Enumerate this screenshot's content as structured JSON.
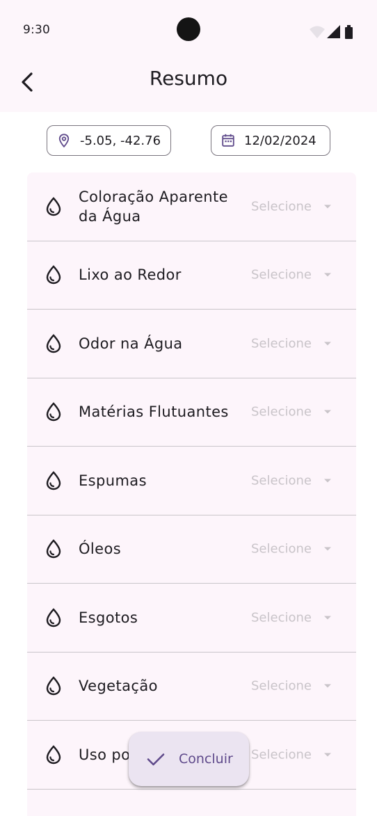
{
  "status_bar": {
    "time": "9:30",
    "icons": [
      "wifi-icon",
      "signal-icon",
      "battery-icon"
    ]
  },
  "app_bar": {
    "title": "Resumo",
    "back_icon": "chevron-left-icon"
  },
  "chips": {
    "location": {
      "icon": "location-pin-icon",
      "value": "-5.05, -42.76"
    },
    "date": {
      "icon": "calendar-icon",
      "value": "12/02/2024"
    }
  },
  "items": [
    {
      "label": "Coloração Aparente da Água",
      "placeholder": "Selecione",
      "icon": "water-drop-icon"
    },
    {
      "label": "Lixo ao Redor",
      "placeholder": "Selecione",
      "icon": "water-drop-icon"
    },
    {
      "label": "Odor na Água",
      "placeholder": "Selecione",
      "icon": "water-drop-icon"
    },
    {
      "label": "Matérias Flutuantes",
      "placeholder": "Selecione",
      "icon": "water-drop-icon"
    },
    {
      "label": "Espumas",
      "placeholder": "Selecione",
      "icon": "water-drop-icon"
    },
    {
      "label": "Óleos",
      "placeholder": "Selecione",
      "icon": "water-drop-icon"
    },
    {
      "label": "Esgotos",
      "placeholder": "Selecione",
      "icon": "water-drop-icon"
    },
    {
      "label": "Vegetação",
      "placeholder": "Selecione",
      "icon": "water-drop-icon"
    },
    {
      "label": "Uso po",
      "placeholder": "Selecione",
      "icon": "water-drop-icon"
    }
  ],
  "fab": {
    "label": "Concluir",
    "icon": "check-icon"
  },
  "colors": {
    "surface": "#fdf6fb",
    "list_background": "#fdf5fb",
    "divider": "#c9c5ca",
    "placeholder": "#c9c4c9",
    "fab_background": "#ebe4f1",
    "accent": "#5f4a8b"
  }
}
